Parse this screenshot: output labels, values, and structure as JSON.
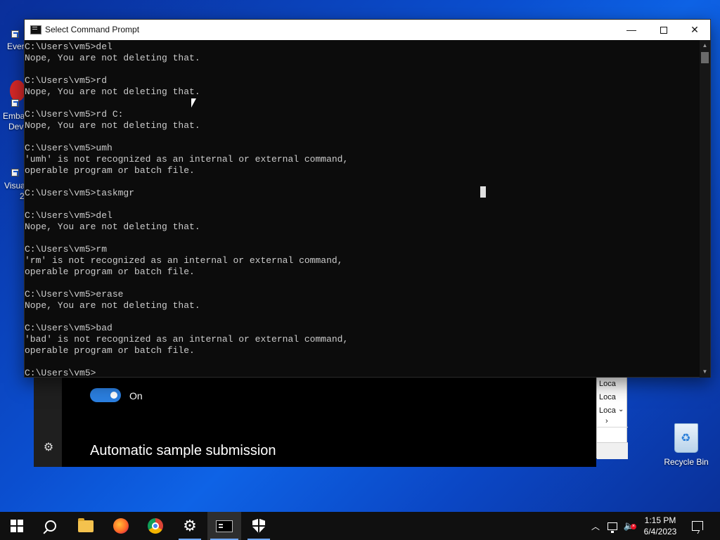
{
  "desktop": {
    "left_labels": [
      "Ever",
      "Emba",
      "Dev",
      "Visua",
      "2"
    ],
    "recycle_bin_label": "Recycle Bin"
  },
  "background_window": {
    "toggle_label": "On",
    "toggle_state": "on",
    "heading": "Automatic sample submission",
    "accent_color": "#2b7fe0"
  },
  "side_list": {
    "items": [
      "Loca",
      "Loca",
      "Loca"
    ]
  },
  "cmd": {
    "title": "Select Command Prompt",
    "lines": [
      "C:\\Users\\vm5>del",
      "Nope, You are not deleting that.",
      "",
      "C:\\Users\\vm5>rd",
      "Nope, You are not deleting that.",
      "",
      "C:\\Users\\vm5>rd C:",
      "Nope, You are not deleting that.",
      "",
      "C:\\Users\\vm5>umh",
      "'umh' is not recognized as an internal or external command,",
      "operable program or batch file.",
      "",
      "C:\\Users\\vm5>taskmgr",
      "",
      "C:\\Users\\vm5>del",
      "Nope, You are not deleting that.",
      "",
      "C:\\Users\\vm5>rm",
      "'rm' is not recognized as an internal or external command,",
      "operable program or batch file.",
      "",
      "C:\\Users\\vm5>erase",
      "Nope, You are not deleting that.",
      "",
      "C:\\Users\\vm5>bad",
      "'bad' is not recognized as an internal or external command,",
      "operable program or batch file.",
      "",
      "C:\\Users\\vm5>"
    ]
  },
  "taskbar": {
    "apps": [
      "start",
      "search",
      "file-explorer",
      "firefox",
      "chrome",
      "settings",
      "command-prompt",
      "windows-security"
    ],
    "active_app": "command-prompt"
  },
  "tray": {
    "time": "1:15 PM",
    "date": "6/4/2023"
  }
}
